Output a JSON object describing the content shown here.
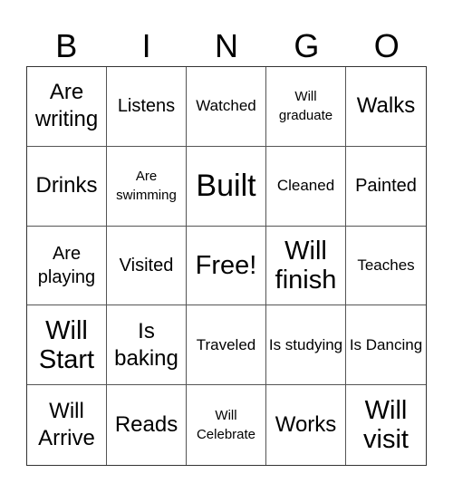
{
  "header": [
    "B",
    "I",
    "N",
    "G",
    "O"
  ],
  "cells": [
    {
      "text": "Are writing",
      "size": "md"
    },
    {
      "text": "Listens",
      "size": "sm"
    },
    {
      "text": "Watched",
      "size": "xs"
    },
    {
      "text": "Will graduate",
      "size": "xxs"
    },
    {
      "text": "Walks",
      "size": "md"
    },
    {
      "text": "Drinks",
      "size": "md"
    },
    {
      "text": "Are swimming",
      "size": "xxs"
    },
    {
      "text": "Built",
      "size": "xl"
    },
    {
      "text": "Cleaned",
      "size": "xs"
    },
    {
      "text": "Painted",
      "size": "sm"
    },
    {
      "text": "Are playing",
      "size": "sm"
    },
    {
      "text": "Visited",
      "size": "sm"
    },
    {
      "text": "Free!",
      "size": "lg"
    },
    {
      "text": "Will finish",
      "size": "lg"
    },
    {
      "text": "Teaches",
      "size": "xs"
    },
    {
      "text": "Will Start",
      "size": "lg"
    },
    {
      "text": "Is baking",
      "size": "md"
    },
    {
      "text": "Traveled",
      "size": "xs"
    },
    {
      "text": "Is studying",
      "size": "xs"
    },
    {
      "text": "Is Dancing",
      "size": "xs"
    },
    {
      "text": "Will Arrive",
      "size": "md"
    },
    {
      "text": "Reads",
      "size": "md"
    },
    {
      "text": "Will Celebrate",
      "size": "xxs"
    },
    {
      "text": "Works",
      "size": "md"
    },
    {
      "text": "Will visit",
      "size": "lg"
    }
  ]
}
